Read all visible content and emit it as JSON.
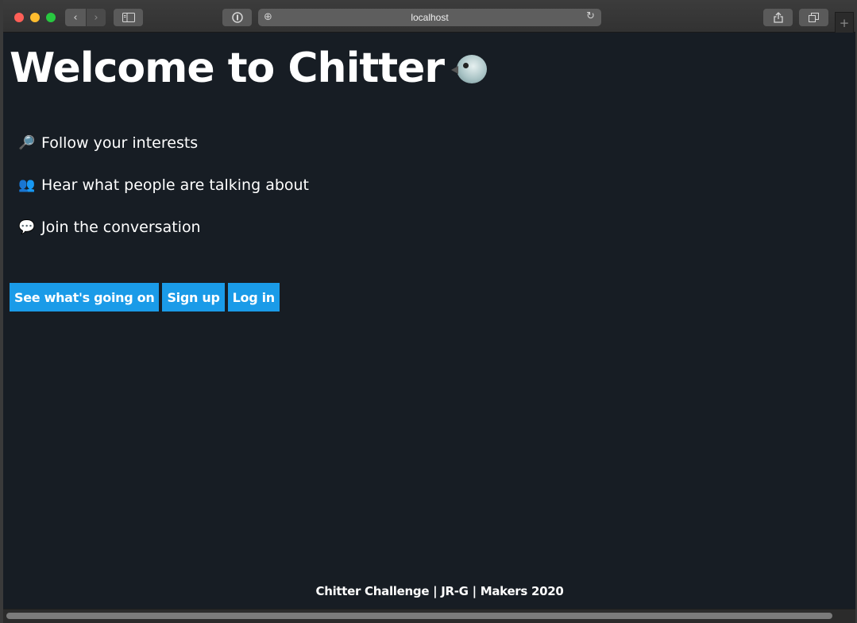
{
  "browser": {
    "url": "localhost",
    "icons": {
      "back": "chevron-left-icon",
      "forward": "chevron-right-icon",
      "sidebar": "sidebar-icon",
      "password": "password-icon",
      "reload": "reload-icon",
      "share": "share-icon",
      "tabs": "tabs-icon",
      "new_tab": "plus-icon"
    }
  },
  "page": {
    "title": "Welcome to Chitter",
    "title_icon": "bird-icon",
    "features": [
      {
        "icon": "magnifier-icon",
        "glyph": "🔎",
        "text": "Follow your interests"
      },
      {
        "icon": "people-icon",
        "glyph": "👥",
        "text": "Hear what people are talking about"
      },
      {
        "icon": "speech-bubble-icon",
        "glyph": "💬",
        "text": "Join the conversation"
      }
    ],
    "buttons": {
      "peek": "See what's going on",
      "signup": "Sign up",
      "login": "Log in"
    },
    "footer": "Chitter Challenge | JR-G | Makers 2020"
  },
  "colors": {
    "background": "#171d24",
    "accent": "#1a9be8",
    "text": "#ffffff"
  }
}
